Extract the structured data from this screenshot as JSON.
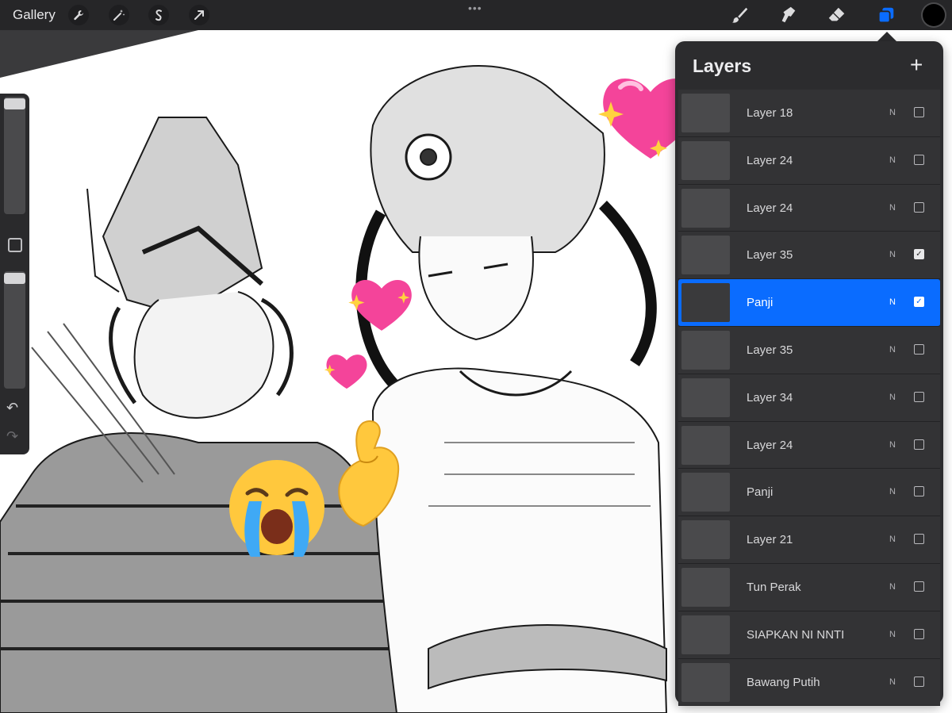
{
  "toolbar": {
    "gallery_label": "Gallery",
    "left_icons": [
      "wrench-icon",
      "magic-wand-icon",
      "selection-icon",
      "transform-icon"
    ],
    "more_glyph": "•••",
    "right_icons": [
      "brush-icon",
      "smudge-icon",
      "eraser-icon",
      "layers-icon"
    ],
    "active_tool": "layers-icon",
    "current_color": "#000000",
    "accent": "#0a6cff"
  },
  "layers_panel": {
    "title": "Layers",
    "add_glyph": "+",
    "layers": [
      {
        "name": "Layer 18",
        "blend": "N",
        "visible": false,
        "selected": false
      },
      {
        "name": "Layer 24",
        "blend": "N",
        "visible": false,
        "selected": false
      },
      {
        "name": "Layer 24",
        "blend": "N",
        "visible": false,
        "selected": false
      },
      {
        "name": "Layer 35",
        "blend": "N",
        "visible": true,
        "selected": false
      },
      {
        "name": "Panji",
        "blend": "N",
        "visible": true,
        "selected": true
      },
      {
        "name": "Layer 35",
        "blend": "N",
        "visible": false,
        "selected": false
      },
      {
        "name": "Layer 34",
        "blend": "N",
        "visible": false,
        "selected": false
      },
      {
        "name": "Layer 24",
        "blend": "N",
        "visible": false,
        "selected": false
      },
      {
        "name": "Panji",
        "blend": "N",
        "visible": false,
        "selected": false
      },
      {
        "name": "Layer 21",
        "blend": "N",
        "visible": false,
        "selected": false
      },
      {
        "name": "Tun Perak",
        "blend": "N",
        "visible": false,
        "selected": false
      },
      {
        "name": "SIAPKAN NI NNTI",
        "blend": "N",
        "visible": false,
        "selected": false
      },
      {
        "name": "Bawang Putih",
        "blend": "N",
        "visible": false,
        "selected": false
      }
    ]
  },
  "sidebar": {
    "brush_size_level": 0.05,
    "opacity_level": 0.05,
    "undo_glyph": "↶",
    "redo_glyph": "↷"
  },
  "stickers": [
    "sparkling-heart-emoji",
    "sparkling-heart-emoji",
    "sparkling-heart-emoji",
    "loudly-crying-face-emoji",
    "pinching-hand-emoji"
  ]
}
